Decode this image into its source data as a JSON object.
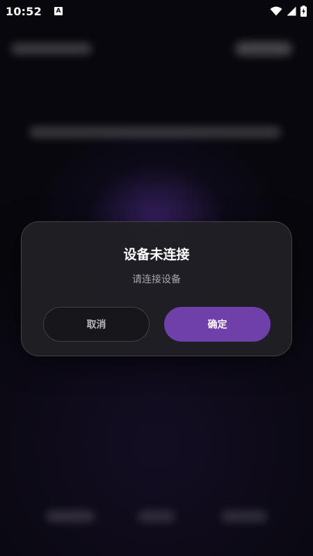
{
  "status_bar": {
    "time": "10:52",
    "notification_icon_letter": "A",
    "icons": [
      "wifi-icon",
      "signal-icon",
      "battery-charging-icon"
    ]
  },
  "dialog": {
    "title": "设备未连接",
    "message": "请连接设备",
    "cancel_label": "取消",
    "confirm_label": "确定"
  },
  "colors": {
    "accent": "#6f3faa",
    "background": "#08070d",
    "dialog_background": "#201f24",
    "title_text": "#ffffff",
    "message_text": "#a7a6ad",
    "cancel_text": "#b9b8bf"
  }
}
